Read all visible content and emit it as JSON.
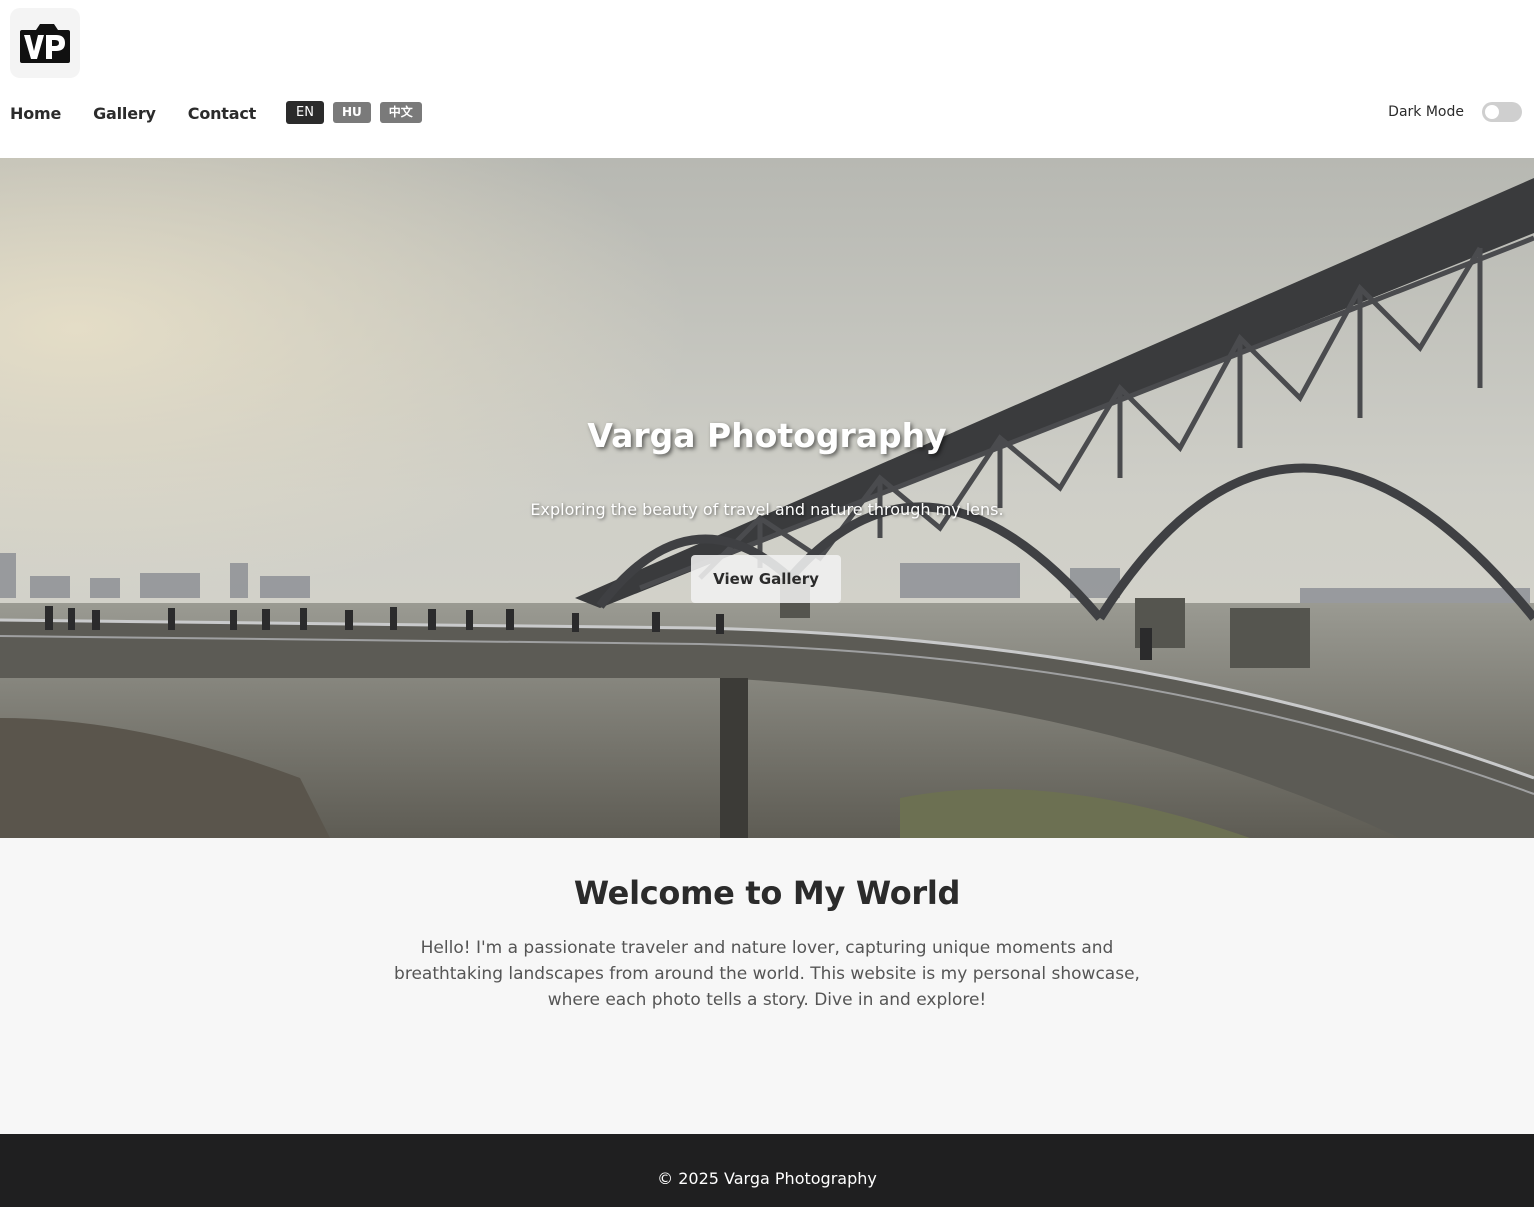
{
  "brand": {
    "logo_text": "VP"
  },
  "nav": {
    "items": [
      {
        "label": "Home"
      },
      {
        "label": "Gallery"
      },
      {
        "label": "Contact"
      }
    ]
  },
  "languages": {
    "options": [
      {
        "label": "EN",
        "active": true
      },
      {
        "label": "HU",
        "active": false
      },
      {
        "label": "中文",
        "active": false
      }
    ]
  },
  "dark_mode": {
    "label": "Dark Mode",
    "enabled": false
  },
  "hero": {
    "title": "Varga Photography",
    "subtitle": "Exploring the beauty of travel and nature through my lens.",
    "cta_label": "View Gallery"
  },
  "welcome": {
    "title": "Welcome to My World",
    "text": "Hello! I'm a passionate traveler and nature lover, capturing unique moments and breathtaking landscapes from around the world. This website is my personal showcase, where each photo tells a story. Dive in and explore!"
  },
  "footer": {
    "copyright": "© 2025 Varga Photography"
  },
  "colors": {
    "text_dark": "#2b2b2b",
    "lang_active": "#2b2b2b",
    "lang_inactive": "#7a7a7a",
    "welcome_bg": "#f7f7f7",
    "footer_bg": "#1f1f20"
  }
}
